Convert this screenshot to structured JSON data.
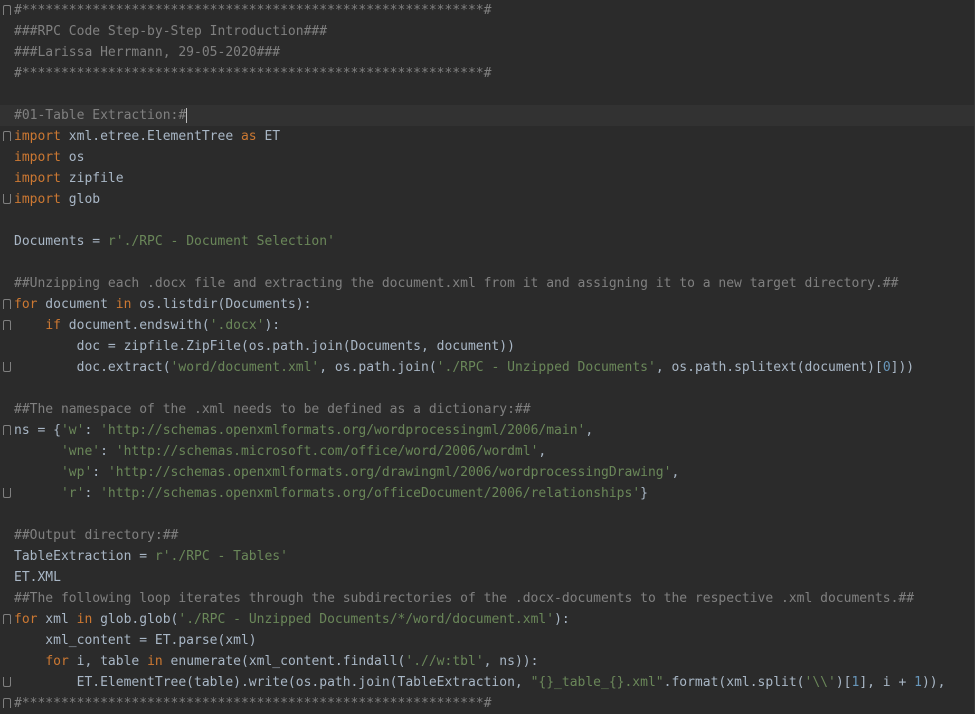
{
  "editor": {
    "theme_colors": {
      "background": "#2b2b2b",
      "current_line": "#323232",
      "comment": "#808080",
      "keyword": "#cc7832",
      "string": "#6a8759",
      "number": "#6897bb",
      "text": "#a9b7c6"
    },
    "lines": [
      {
        "fold": "start",
        "tokens": [
          {
            "t": "comment",
            "v": "#***********************************************************#"
          }
        ]
      },
      {
        "tokens": [
          {
            "t": "comment",
            "v": "###RPC Code Step-by-Step Introduction###"
          }
        ]
      },
      {
        "tokens": [
          {
            "t": "comment",
            "v": "###Larissa Herrmann, 29-05-2020###"
          }
        ]
      },
      {
        "tokens": [
          {
            "t": "comment",
            "v": "#***********************************************************#"
          }
        ]
      },
      {
        "tokens": []
      },
      {
        "current": true,
        "caret": true,
        "tokens": [
          {
            "t": "comment",
            "v": "#01-Table Extraction:#"
          }
        ]
      },
      {
        "fold": "start",
        "tokens": [
          {
            "t": "keyword",
            "v": "import"
          },
          {
            "t": "plain",
            "v": " xml.etree.ElementTree "
          },
          {
            "t": "keyword",
            "v": "as"
          },
          {
            "t": "plain",
            "v": " ET"
          }
        ]
      },
      {
        "tokens": [
          {
            "t": "keyword",
            "v": "import"
          },
          {
            "t": "plain",
            "v": " os"
          }
        ]
      },
      {
        "tokens": [
          {
            "t": "keyword",
            "v": "import"
          },
          {
            "t": "plain",
            "v": " zipfile"
          }
        ]
      },
      {
        "fold": "end",
        "tokens": [
          {
            "t": "keyword",
            "v": "import"
          },
          {
            "t": "plain",
            "v": " glob"
          }
        ]
      },
      {
        "tokens": []
      },
      {
        "tokens": [
          {
            "t": "plain",
            "v": "Documents = "
          },
          {
            "t": "string",
            "v": "r'./RPC - Document Selection'"
          }
        ]
      },
      {
        "tokens": []
      },
      {
        "tokens": [
          {
            "t": "comment",
            "v": "##Unzipping each .docx file and extracting the document.xml from it and assigning it to a new target directory.##"
          }
        ]
      },
      {
        "fold": "start",
        "tokens": [
          {
            "t": "keyword",
            "v": "for"
          },
          {
            "t": "plain",
            "v": " document "
          },
          {
            "t": "keyword",
            "v": "in"
          },
          {
            "t": "plain",
            "v": " os.listdir(Documents):"
          }
        ]
      },
      {
        "fold": "start",
        "tokens": [
          {
            "t": "plain",
            "v": "    "
          },
          {
            "t": "keyword",
            "v": "if"
          },
          {
            "t": "plain",
            "v": " document.endswith("
          },
          {
            "t": "string",
            "v": "'.docx'"
          },
          {
            "t": "plain",
            "v": "):"
          }
        ]
      },
      {
        "tokens": [
          {
            "t": "plain",
            "v": "        doc = zipfile.ZipFile(os.path.join(Documents, document))"
          }
        ]
      },
      {
        "fold": "end",
        "tokens": [
          {
            "t": "plain",
            "v": "        doc.extract("
          },
          {
            "t": "string",
            "v": "'word/document.xml'"
          },
          {
            "t": "plain",
            "v": ", os.path.join("
          },
          {
            "t": "string",
            "v": "'./RPC - Unzipped Documents'"
          },
          {
            "t": "plain",
            "v": ", os.path.splitext(document)["
          },
          {
            "t": "number",
            "v": "0"
          },
          {
            "t": "plain",
            "v": "]))"
          }
        ]
      },
      {
        "tokens": []
      },
      {
        "tokens": [
          {
            "t": "comment",
            "v": "##The namespace of the .xml needs to be defined as a dictionary:##"
          }
        ]
      },
      {
        "fold": "start",
        "tokens": [
          {
            "t": "plain",
            "v": "ns = {"
          },
          {
            "t": "string",
            "v": "'w'"
          },
          {
            "t": "plain",
            "v": ": "
          },
          {
            "t": "string",
            "v": "'http://schemas.openxmlformats.org/wordprocessingml/2006/main'"
          },
          {
            "t": "plain",
            "v": ","
          }
        ]
      },
      {
        "tokens": [
          {
            "t": "plain",
            "v": "      "
          },
          {
            "t": "string",
            "v": "'wne'"
          },
          {
            "t": "plain",
            "v": ": "
          },
          {
            "t": "string",
            "v": "'http://schemas.microsoft.com/office/word/2006/wordml'"
          },
          {
            "t": "plain",
            "v": ","
          }
        ]
      },
      {
        "tokens": [
          {
            "t": "plain",
            "v": "      "
          },
          {
            "t": "string",
            "v": "'wp'"
          },
          {
            "t": "plain",
            "v": ": "
          },
          {
            "t": "string",
            "v": "'http://schemas.openxmlformats.org/drawingml/2006/wordprocessingDrawing'"
          },
          {
            "t": "plain",
            "v": ","
          }
        ]
      },
      {
        "fold": "end",
        "tokens": [
          {
            "t": "plain",
            "v": "      "
          },
          {
            "t": "string",
            "v": "'r'"
          },
          {
            "t": "plain",
            "v": ": "
          },
          {
            "t": "string",
            "v": "'http://schemas.openxmlformats.org/officeDocument/2006/relationships'"
          },
          {
            "t": "plain",
            "v": "}"
          }
        ]
      },
      {
        "tokens": []
      },
      {
        "tokens": [
          {
            "t": "comment",
            "v": "##Output directory:##"
          }
        ]
      },
      {
        "tokens": [
          {
            "t": "plain",
            "v": "TableExtraction = "
          },
          {
            "t": "string",
            "v": "r'./RPC - Tables'"
          }
        ]
      },
      {
        "tokens": [
          {
            "t": "plain",
            "v": "ET.XML"
          }
        ]
      },
      {
        "tokens": [
          {
            "t": "comment",
            "v": "##The following loop iterates through the subdirectories of the .docx-documents to the respective .xml documents.##"
          }
        ]
      },
      {
        "fold": "start",
        "tokens": [
          {
            "t": "keyword",
            "v": "for"
          },
          {
            "t": "plain",
            "v": " xml "
          },
          {
            "t": "keyword",
            "v": "in"
          },
          {
            "t": "plain",
            "v": " glob.glob("
          },
          {
            "t": "string",
            "v": "'./RPC - Unzipped Documents/*/word/document.xml'"
          },
          {
            "t": "plain",
            "v": "):"
          }
        ]
      },
      {
        "tokens": [
          {
            "t": "plain",
            "v": "    xml_content = ET.parse(xml)"
          }
        ]
      },
      {
        "tokens": [
          {
            "t": "plain",
            "v": "    "
          },
          {
            "t": "keyword",
            "v": "for"
          },
          {
            "t": "plain",
            "v": " i, table "
          },
          {
            "t": "keyword",
            "v": "in"
          },
          {
            "t": "plain",
            "v": " enumerate(xml_content.findall("
          },
          {
            "t": "string",
            "v": "'.//w:tbl'"
          },
          {
            "t": "plain",
            "v": ", ns)):"
          }
        ]
      },
      {
        "fold": "end",
        "tokens": [
          {
            "t": "plain",
            "v": "        ET.ElementTree(table).write(os.path.join(TableExtraction, "
          },
          {
            "t": "string",
            "v": "\"{}_table_{}.xml\""
          },
          {
            "t": "plain",
            "v": ".format(xml.split("
          },
          {
            "t": "string",
            "v": "'\\\\'"
          },
          {
            "t": "plain",
            "v": ")["
          },
          {
            "t": "number",
            "v": "1"
          },
          {
            "t": "plain",
            "v": "], i + "
          },
          {
            "t": "number",
            "v": "1"
          },
          {
            "t": "plain",
            "v": ")),"
          }
        ]
      },
      {
        "fold": "start",
        "tokens": [
          {
            "t": "comment",
            "v": "#***********************************************************#"
          }
        ]
      }
    ]
  }
}
